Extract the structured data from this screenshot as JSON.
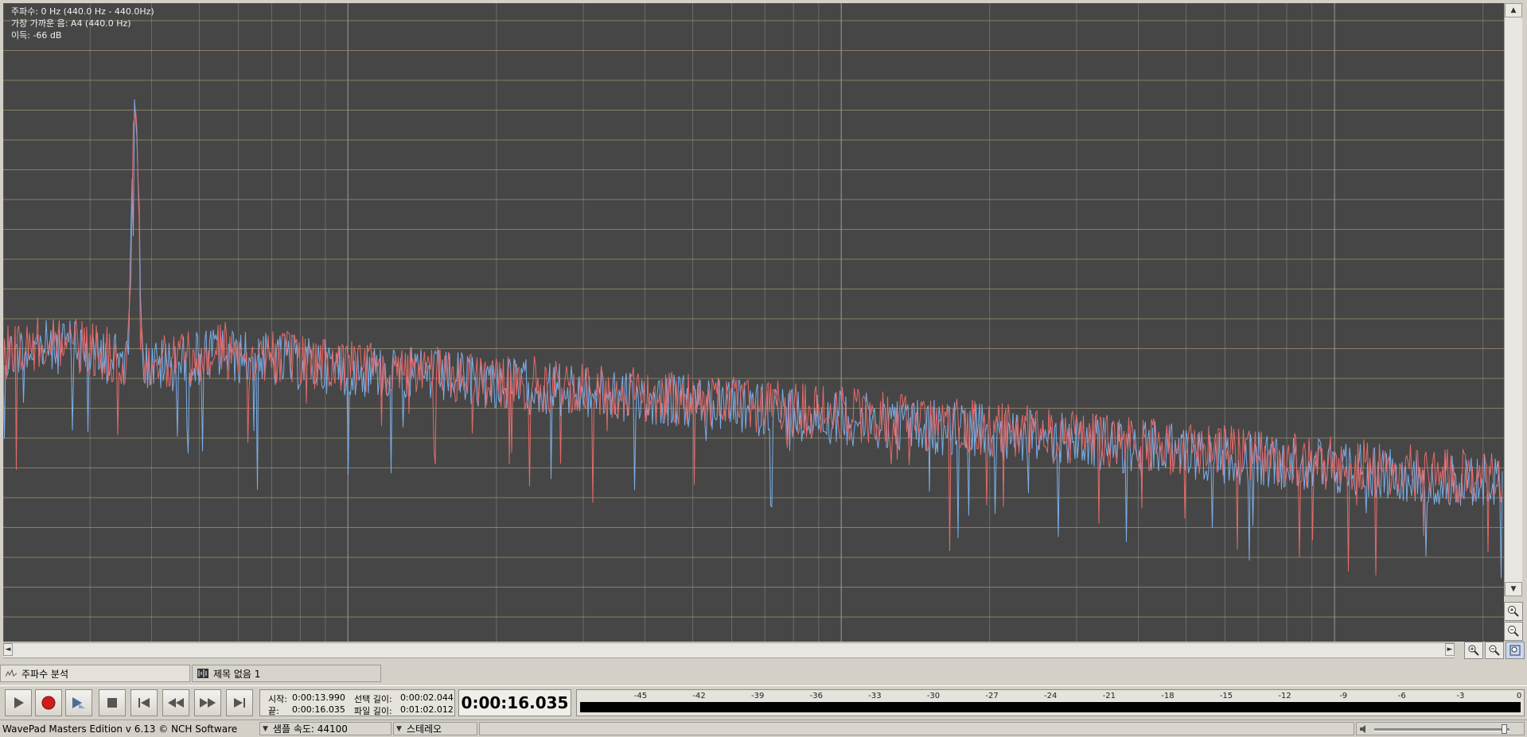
{
  "analysis": {
    "frequency_readout": "주파수: 0 Hz (440.0 Hz - 440.0Hz)",
    "nearest_note_readout": "가장 가까운 음: A4 (440.0 Hz)",
    "gain_readout": "이득: -66 dB"
  },
  "tabs": [
    {
      "label": "주파수 분석",
      "icon": "spectrum-icon"
    },
    {
      "label": "제목 없음 1",
      "icon": "waveform-icon"
    }
  ],
  "transport": {
    "buttons": [
      "play-icon",
      "record-icon",
      "play-selection-icon",
      "stop-icon",
      "skip-to-start-icon",
      "rewind-icon",
      "fast-forward-icon",
      "skip-to-end-icon"
    ],
    "start_label": "시작:",
    "start_value": "0:00:13.990",
    "end_label": "끝:",
    "end_value": "0:00:16.035",
    "selection_length_label": "선택 길이:",
    "selection_length_value": "0:00:02.044",
    "file_length_label": "파일 길이:",
    "file_length_value": "0:01:02.012",
    "current_time": "0:00:16.035"
  },
  "level_meter": {
    "labels": [
      "-45",
      "-42",
      "-39",
      "-36",
      "-33",
      "-30",
      "-27",
      "-24",
      "-21",
      "-18",
      "-15",
      "-12",
      "-9",
      "-6",
      "-3",
      "0"
    ]
  },
  "status_bar": {
    "app_name": "WavePad Masters Edition v 6.13 © NCH Software",
    "sample_rate": "샘플 속도: 44100",
    "channels": "스테레오"
  },
  "colors": {
    "plot_background": "#464646",
    "grid_vertical": "#8c8c8c",
    "grid_horizontal": "#a89a70",
    "left_channel": "#7aaee8",
    "right_channel": "#e46a6a"
  }
}
